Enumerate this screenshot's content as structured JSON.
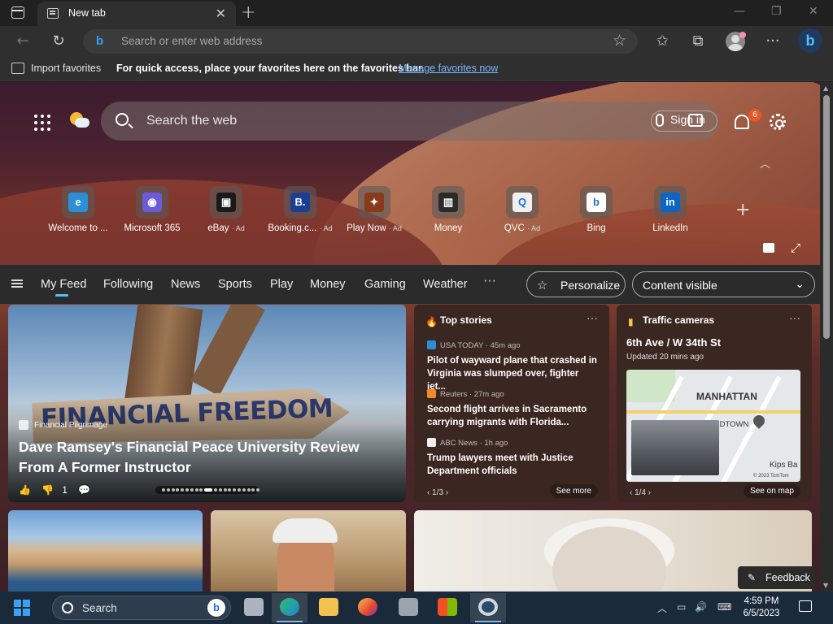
{
  "browser": {
    "tab_title": "New tab",
    "tab_close": "✕",
    "new_tab": "+",
    "window_controls": {
      "minimize": "—",
      "restore": "❐",
      "close": "✕"
    },
    "back": "←",
    "refresh": "↻",
    "address_placeholder": "Search or enter web address",
    "favorite_star": "☆",
    "favorites_icon": "✩",
    "collections_icon": "⧉",
    "more_icon": "···",
    "copilot_letter": "b"
  },
  "favbar": {
    "import_label": "Import favorites",
    "tip": "For quick access, place your favorites here on the favorites bar.",
    "manage_link": "Manage favorites now"
  },
  "newtab": {
    "search_placeholder": "Search the web",
    "sign_in": "Sign in",
    "notification_count": "6",
    "collapse": "︿",
    "add_link": "+",
    "expand": "⤢",
    "quicklinks": [
      {
        "label": "Welcome to ...",
        "ad": "",
        "glyph": "e",
        "color": "#2a8fd6"
      },
      {
        "label": "Microsoft 365",
        "ad": "",
        "glyph": "◉",
        "color": "#6b5bd8"
      },
      {
        "label": "eBay",
        "ad": "Ad",
        "glyph": "▣",
        "color": "#1a1a1a"
      },
      {
        "label": "Booking.c...",
        "ad": "Ad",
        "glyph": "B.",
        "color": "#1c3f94"
      },
      {
        "label": "Play Now",
        "ad": "Ad",
        "glyph": "✦",
        "color": "#8a3a1c"
      },
      {
        "label": "Money",
        "ad": "",
        "glyph": "▥",
        "color": "#2b2b2b"
      },
      {
        "label": "QVC",
        "ad": "Ad",
        "glyph": "Q",
        "color": "#f0f0f0"
      },
      {
        "label": "Bing",
        "ad": "",
        "glyph": "b",
        "color": "#ffffff"
      },
      {
        "label": "LinkedIn",
        "ad": "",
        "glyph": "in",
        "color": "#0a66c2"
      }
    ]
  },
  "feednav": {
    "items": [
      "My Feed",
      "Following",
      "News",
      "Sports",
      "Play",
      "Money",
      "Gaming",
      "Weather"
    ],
    "more": "···",
    "personalize": "Personalize",
    "content_visible": "Content visible",
    "chevron": "⌄"
  },
  "hero": {
    "sign_text": "FINANCIAL FREEDOM",
    "source": "Financial Pilgrimage",
    "title": "Dave Ramsey's Financial Peace University Review From A Former Instructor",
    "like": "👍",
    "dislike_count": "1",
    "comment": "💬"
  },
  "top_stories": {
    "title": "Top stories",
    "more": "···",
    "stories": [
      {
        "source": "USA TODAY · 45m ago",
        "title": "Pilot of wayward plane that crashed in Virginia was slumped over, fighter jet...",
        "logo": "#2a8fd6"
      },
      {
        "source": "Reuters · 27m ago",
        "title": "Second flight arrives in Sacramento carrying migrants with Florida...",
        "logo": "#f08a24"
      },
      {
        "source": "ABC News · 1h ago",
        "title": "Trump lawyers meet with Justice Department officials",
        "logo": "#f0f0f0"
      }
    ],
    "pager": "‹  1/3  ›",
    "see_more": "See more"
  },
  "traffic": {
    "title": "Traffic cameras",
    "more": "···",
    "location": "6th Ave / W 34th St",
    "updated": "Updated 20 mins ago",
    "map_label": "MANHATTAN",
    "map_midtown": "IDTOWN",
    "map_kips": "Kips Ba",
    "map_copy": "© 2023 TomTom",
    "pager": "‹  1/4  ›",
    "see_on_map": "See on map"
  },
  "feedback": {
    "label": "Feedback",
    "icon": "✎"
  },
  "taskbar": {
    "search": "Search",
    "time": "4:59 PM",
    "date": "6/5/2023",
    "tray_chevron": "︿",
    "keyboard": "⌨"
  }
}
